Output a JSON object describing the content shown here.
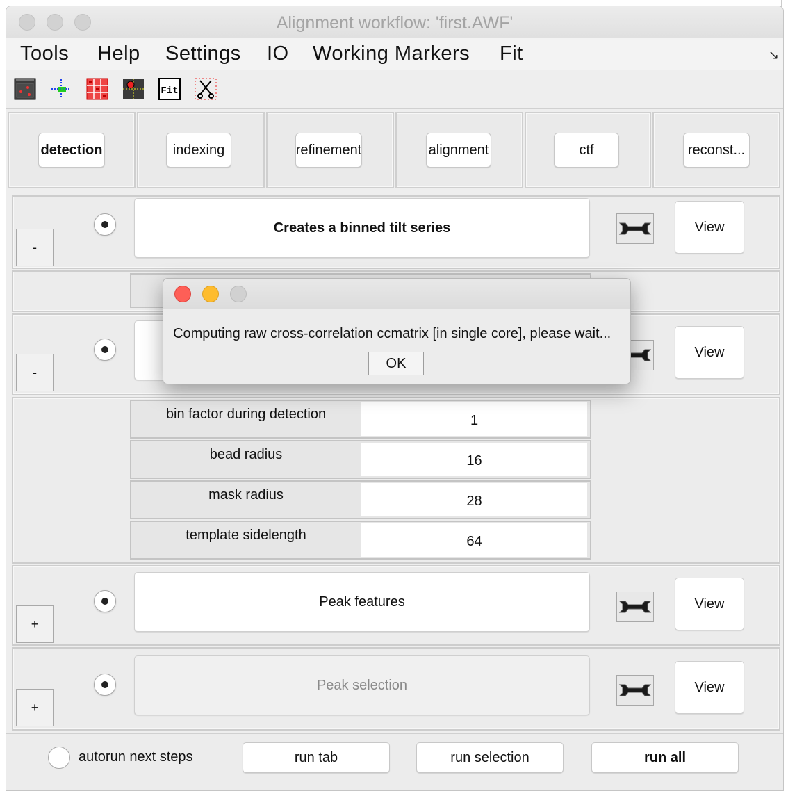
{
  "window": {
    "title": "Alignment workflow: 'first.AWF'"
  },
  "menu": [
    "Tools",
    "Help",
    "Settings",
    "IO",
    "Working Markers",
    "Fit"
  ],
  "toolbar_icons": [
    "marker-window-icon",
    "move-crosshair-icon",
    "grid-icon",
    "target-marker-icon",
    "fit-icon",
    "scissors-icon"
  ],
  "toolbar_fit_label": "Fit",
  "tabs": [
    "detection",
    "indexing",
    "refinement",
    "alignment",
    "ctf",
    "reconst..."
  ],
  "sections": {
    "binned": {
      "toggle": "-",
      "label": "Creates a binned tilt series",
      "view": "View"
    },
    "detect": {
      "toggle": "-",
      "view": "View"
    },
    "peak_features": {
      "toggle": "+",
      "label": "Peak features",
      "view": "View"
    },
    "peak_selection": {
      "toggle": "+",
      "label": "Peak selection",
      "view": "View"
    }
  },
  "params": [
    {
      "label": "bin factor during detection",
      "value": "1"
    },
    {
      "label": "bead radius",
      "value": "16"
    },
    {
      "label": "mask radius",
      "value": "28"
    },
    {
      "label": "template sidelength",
      "value": "64"
    }
  ],
  "bottom": {
    "autorun": "autorun next steps",
    "run_tab": "run tab",
    "run_selection": "run selection",
    "run_all": "run all"
  },
  "dialog": {
    "message": "Computing raw cross-correlation ccmatrix [in single core], please wait...",
    "ok": "OK"
  },
  "colors": {
    "close": "#fe5f57",
    "minimize": "#febc2e",
    "zoom_inactive": "#d1d1d1"
  }
}
